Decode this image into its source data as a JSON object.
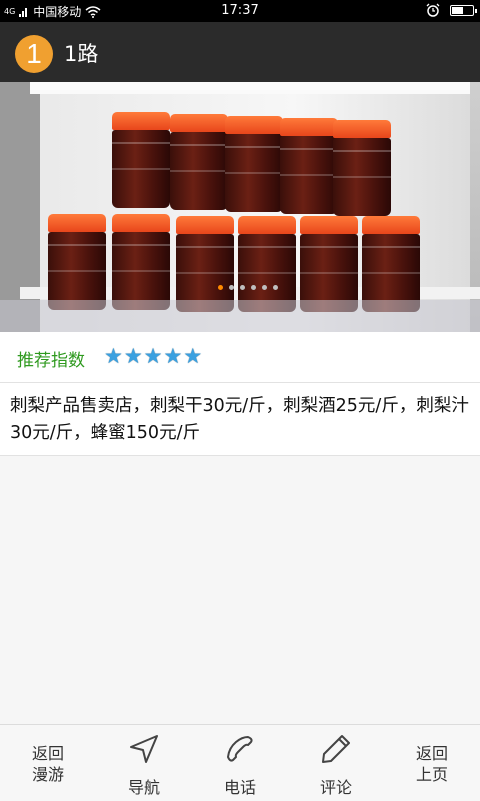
{
  "status_bar": {
    "network": "4G",
    "carrier": "中国移动",
    "time": "17:37",
    "wifi_icon": "wifi-icon",
    "alarm_icon": "alarm-icon",
    "battery_level": 0.55
  },
  "header": {
    "route_number": "1",
    "title": "1路"
  },
  "carousel": {
    "page_count": 6,
    "active_index": 0,
    "accent_color": "#ff8a00"
  },
  "rating": {
    "label": "推荐指数",
    "stars": 5,
    "max_stars": 5,
    "label_color": "#2f9a1f",
    "star_color": "#3aa0e0"
  },
  "description": "刺梨产品售卖店，刺梨干30元/斤，刺梨酒25元/斤，刺梨汁30元/斤，蜂蜜150元/斤",
  "bottom_nav": {
    "back_tour": [
      "返回",
      "漫游"
    ],
    "navigate": "导航",
    "phone": "电话",
    "review": "评论",
    "back_page": [
      "返回",
      "上页"
    ],
    "icons": [
      "navigation-arrow-icon",
      "phone-icon",
      "pencil-icon"
    ]
  }
}
